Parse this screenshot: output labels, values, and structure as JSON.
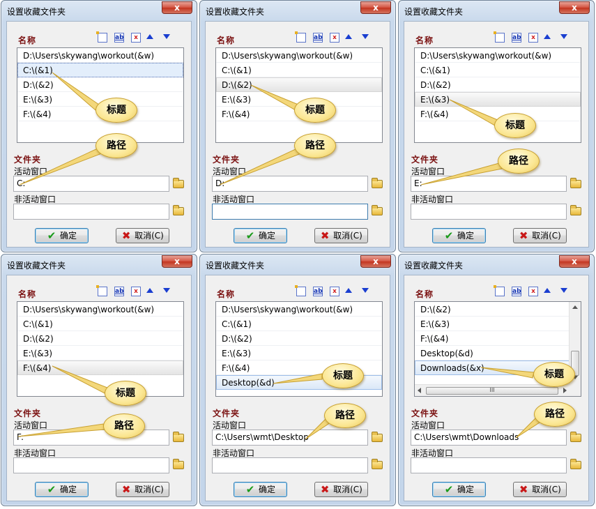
{
  "dialog_title": "设置收藏文件夹",
  "close_glyph": "x",
  "header_name": "名称",
  "toolbar": {
    "new_title": "新建",
    "rename_text": "ab",
    "delete_text": "x"
  },
  "folder_section": "文件夹",
  "active_window_label": "活动窗口",
  "inactive_window_label": "非活动窗口",
  "ok_label": "确定",
  "cancel_label": "取消(C)",
  "callout_title": "标题",
  "callout_path": "路径",
  "scroll_grip": "III",
  "dialogs": [
    {
      "items": [
        "D:\\Users\\skywang\\workout(&w)",
        "C:\\(&1)",
        "D:\\(&2)",
        "E:\\(&3)",
        "F:\\(&4)"
      ],
      "active_path": "C:",
      "inactive_path": ""
    },
    {
      "items": [
        "D:\\Users\\skywang\\workout(&w)",
        "C:\\(&1)",
        "D:\\(&2)",
        "E:\\(&3)",
        "F:\\(&4)"
      ],
      "active_path": "D:",
      "inactive_path": ""
    },
    {
      "items": [
        "D:\\Users\\skywang\\workout(&w)",
        "C:\\(&1)",
        "D:\\(&2)",
        "E:\\(&3)",
        "F:\\(&4)"
      ],
      "active_path": "E:",
      "inactive_path": ""
    },
    {
      "items": [
        "D:\\Users\\skywang\\workout(&w)",
        "C:\\(&1)",
        "D:\\(&2)",
        "E:\\(&3)",
        "F:\\(&4)"
      ],
      "active_path": "F:",
      "inactive_path": ""
    },
    {
      "items": [
        "D:\\Users\\skywang\\workout(&w)",
        "C:\\(&1)",
        "D:\\(&2)",
        "E:\\(&3)",
        "F:\\(&4)",
        "Desktop(&d)"
      ],
      "active_path": "C:\\Users\\wmt\\Desktop",
      "inactive_path": ""
    },
    {
      "items": [
        "D:\\(&2)",
        "E:\\(&3)",
        "F:\\(&4)",
        "Desktop(&d)",
        "Downloads(&x)"
      ],
      "active_path": "C:\\Users\\wmt\\Downloads",
      "inactive_path": ""
    }
  ],
  "colors": {
    "title_bar": "#c4d5ea",
    "close_button": "#c3341f",
    "section_header": "#7a1010",
    "callout_fill": "#fbe793"
  }
}
